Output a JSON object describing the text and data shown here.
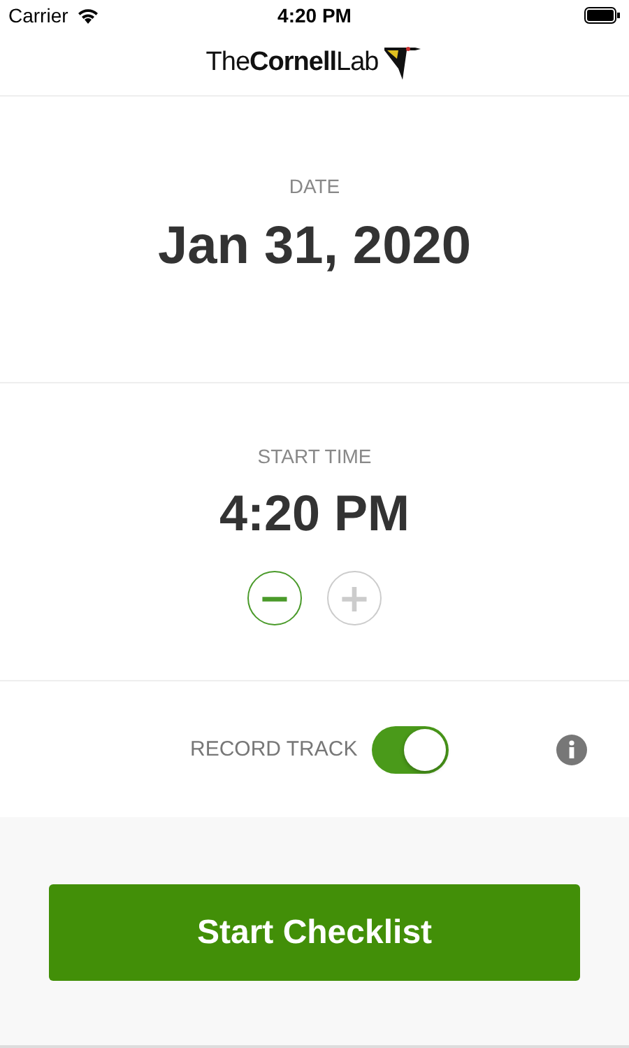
{
  "status_bar": {
    "carrier": "Carrier",
    "time": "4:20 PM"
  },
  "header": {
    "logo": "The**Cornell**Lab"
  },
  "date": {
    "label": "DATE",
    "value": "Jan 31, 2020"
  },
  "start_time": {
    "label": "START TIME",
    "value": "4:20 PM",
    "decrement": {
      "symbol": "−",
      "disabled": false
    },
    "increment": {
      "symbol": "+",
      "disabled": true
    }
  },
  "record_track": {
    "label": "RECORD TRACK",
    "on": true
  },
  "primary_button": {
    "label": "Start Checklist"
  }
}
